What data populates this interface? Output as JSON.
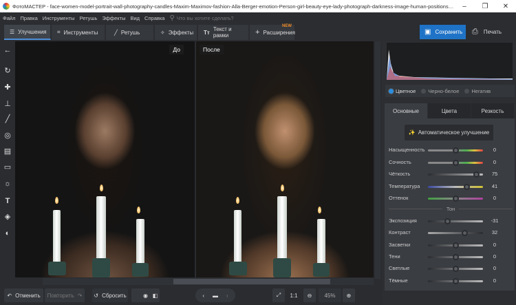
{
  "window": {
    "title": "ФотоМАСТЕР - face-women-model-portrait-wall-photography-candles-Maxim-Maximov-fashion-Alla-Berger-emotion-Person-girl-beauty-eye-lady-photograph-darkness-image-human-positions-portrait-photog...",
    "minimize": "–",
    "restore": "❐",
    "close": "✕"
  },
  "menu": {
    "items": [
      "Файл",
      "Правка",
      "Инструменты",
      "Ретушь",
      "Эффекты",
      "Вид",
      "Справка"
    ],
    "search_placeholder": "Что вы хотите сделать?"
  },
  "toolbar": {
    "tabs": [
      {
        "label": "Улучшения",
        "icon": "sliders-icon"
      },
      {
        "label": "Инструменты",
        "icon": "crop-icon"
      },
      {
        "label": "Ретушь",
        "icon": "brush-icon"
      },
      {
        "label": "Эффекты",
        "icon": "magic-wand-icon"
      },
      {
        "label": "Текст и рамки",
        "icon": "text-icon"
      },
      {
        "label": "Расширения",
        "icon": "plus-icon",
        "badge": "NEW"
      }
    ],
    "save": "Сохранить",
    "print": "Печать"
  },
  "preview": {
    "before_label": "До",
    "after_label": "После"
  },
  "bottom": {
    "undo": "Отменить",
    "redo": "Повторить",
    "reset": "Сбросить",
    "fit": "1:1",
    "zoom": "45%"
  },
  "panel": {
    "modes": [
      {
        "label": "Цветное",
        "selected": true
      },
      {
        "label": "Черно-белое",
        "selected": false
      },
      {
        "label": "Негатив",
        "selected": false
      }
    ],
    "tabs": [
      "Основные",
      "Цвета",
      "Резкость"
    ],
    "auto_button": "Автоматическое улучшение",
    "tone_header": "Тон",
    "color_sliders": [
      {
        "label": "Насыщенность",
        "value": 0
      },
      {
        "label": "Сочность",
        "value": 0
      },
      {
        "label": "Чёткость",
        "value": 75
      },
      {
        "label": "Температура",
        "value": 41
      },
      {
        "label": "Оттенок",
        "value": 0
      }
    ],
    "tone_sliders": [
      {
        "label": "Экспозиция",
        "value": -31
      },
      {
        "label": "Контраст",
        "value": 32
      },
      {
        "label": "Засветки",
        "value": 0
      },
      {
        "label": "Тени",
        "value": 0
      },
      {
        "label": "Светлые",
        "value": 0
      },
      {
        "label": "Тёмные",
        "value": 0
      }
    ]
  }
}
